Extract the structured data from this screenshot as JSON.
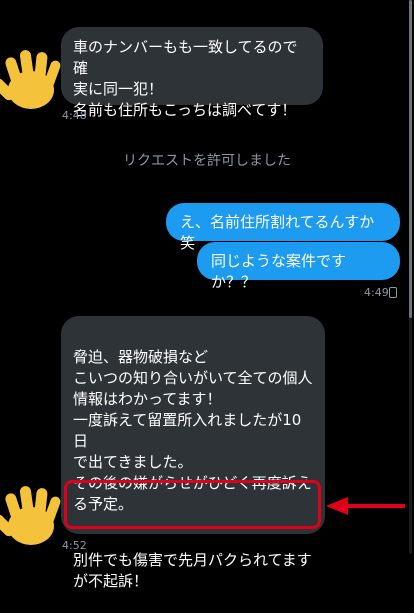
{
  "messages": {
    "m1": {
      "text": "車のナンバーもも一致してるので確\n実に同一犯！\n名前も住所もこっちは調べてす！",
      "time": "4:48"
    },
    "system_notice": "リクエストを許可しました",
    "m2": {
      "text": "え、名前住所割れてるんすか笑"
    },
    "m3": {
      "text": "同じような案件ですか？？",
      "time": "4:49"
    },
    "m4": {
      "text": "脅迫、器物破損など\nこいつの知り合いがいて全ての個人\n情報はわかってます！\n一度訴えて留置所入れましたが10日\nで出てきました。\nその後の嫌がらせがひどく再度訴え\nる予定。",
      "highlighted_text": "別件でも傷害で先月パクられてます\nが不起訴！",
      "time": "4:52"
    }
  },
  "icons": {
    "received_indicator": "waving-hand-icon",
    "annotation_arrow": "red-arrow-icon"
  },
  "colors": {
    "background": "#000000",
    "incoming_bubble": "#2e3338",
    "outgoing_bubble": "#1d9bf0",
    "highlight": "#e0001b"
  }
}
